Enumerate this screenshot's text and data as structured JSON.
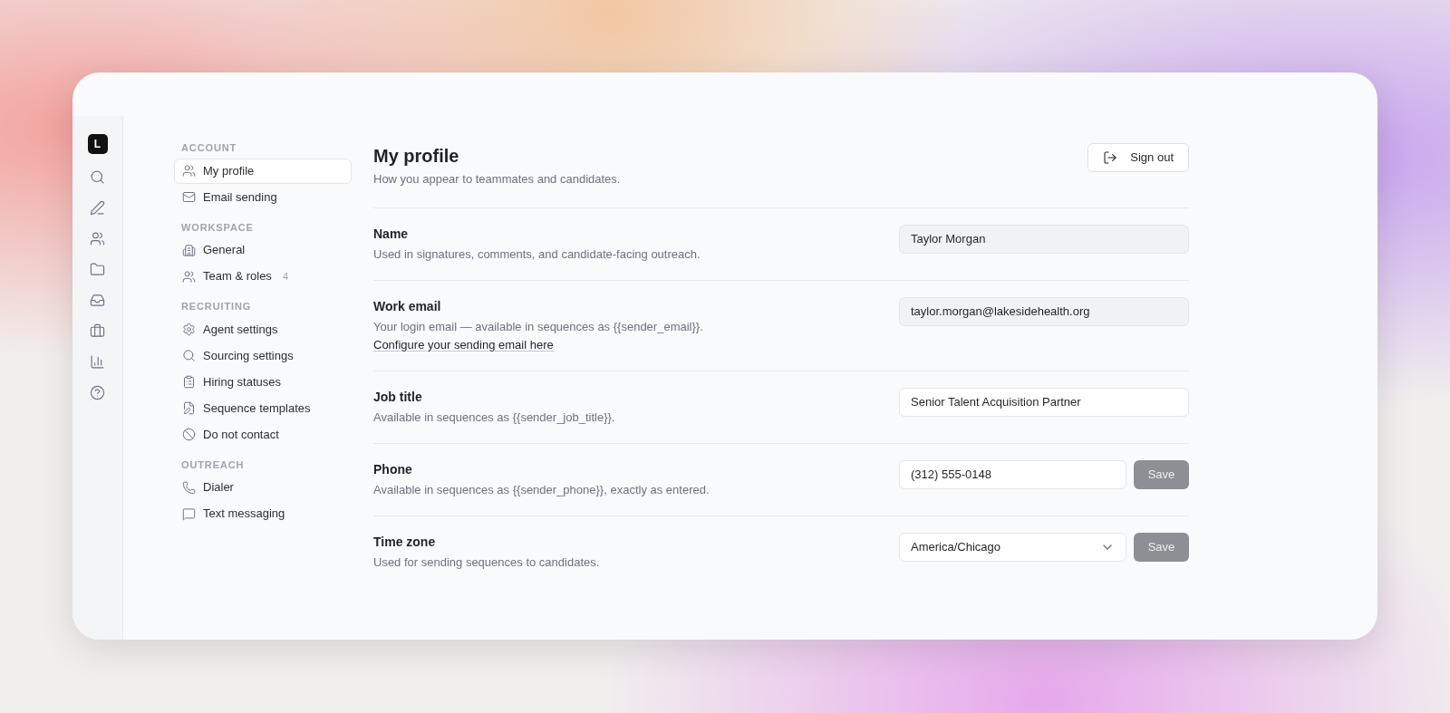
{
  "rail": {
    "logo": "L"
  },
  "nav": [
    {
      "heading": "ACCOUNT",
      "items": [
        {
          "label": "My profile",
          "selected": true
        },
        {
          "label": "Email sending",
          "selected": false
        }
      ]
    },
    {
      "heading": "WORKSPACE",
      "items": [
        {
          "label": "General",
          "selected": false
        },
        {
          "label": "Team & roles",
          "count": "4",
          "selected": false
        }
      ]
    },
    {
      "heading": "RECRUITING",
      "items": [
        {
          "label": "Agent settings",
          "selected": false
        },
        {
          "label": "Sourcing settings",
          "selected": false
        },
        {
          "label": "Hiring statuses",
          "selected": false
        },
        {
          "label": "Sequence templates",
          "selected": false
        },
        {
          "label": "Do not contact",
          "selected": false
        }
      ]
    },
    {
      "heading": "OUTREACH",
      "items": [
        {
          "label": "Dialer",
          "selected": false
        },
        {
          "label": "Text messaging",
          "selected": false
        }
      ]
    }
  ],
  "header": {
    "title": "My profile",
    "subtitle": "How you appear to teammates and candidates.",
    "sign_out": "Sign out"
  },
  "fields": [
    {
      "label": "Name",
      "description": "Used in signatures, comments, and candidate-facing outreach.",
      "kind": "text",
      "value": "Taylor Morgan",
      "disabled": true
    },
    {
      "label": "Work email",
      "description": "Your login email — available in sequences as {{sender_email}}.",
      "link": "Configure your sending email here",
      "kind": "text",
      "value": "taylor.morgan@lakesidehealth.org",
      "disabled": true
    },
    {
      "label": "Job title",
      "description": "Available in sequences as {{sender_job_title}}.",
      "kind": "text",
      "value": "Senior Talent Acquisition Partner",
      "disabled": false
    },
    {
      "label": "Phone",
      "description": "Available in sequences as {{sender_phone}}, exactly as entered.",
      "kind": "text",
      "value": "(312) 555-0148",
      "disabled": false,
      "save": {
        "label": "Save",
        "disabled": true
      }
    },
    {
      "label": "Time zone",
      "description": "Used for sending sequences to candidates.",
      "kind": "select",
      "value": "America/Chicago",
      "disabled": false,
      "save": {
        "label": "Save",
        "disabled": true
      }
    }
  ]
}
